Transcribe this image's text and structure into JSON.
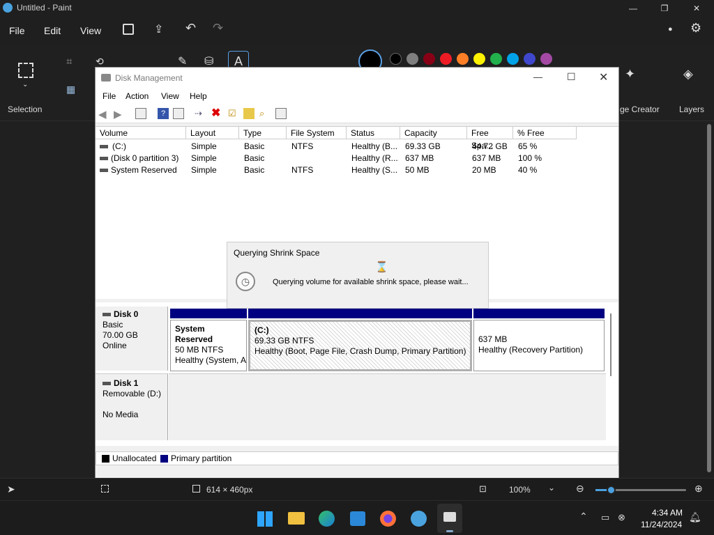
{
  "paint": {
    "title": "Untitled - Paint",
    "menu": [
      "File",
      "Edit",
      "View"
    ],
    "ribbon": {
      "selection": "Selection",
      "image_creator": "ge Creator",
      "layers": "Layers"
    },
    "colors": [
      "#000000",
      "#7f7f7f",
      "#880015",
      "#ed1c24",
      "#ff7f27",
      "#fff200",
      "#22b14c",
      "#00a2e8",
      "#3f48cc",
      "#a349a4"
    ],
    "status": {
      "size": "614 × 460px",
      "zoom": "100%",
      "zoom_fraction": 0.17
    }
  },
  "dm": {
    "title": "Disk Management",
    "menu": [
      "File",
      "Action",
      "View",
      "Help"
    ],
    "columns": [
      "Volume",
      "Layout",
      "Type",
      "File System",
      "Status",
      "Capacity",
      "Free Spa...",
      "% Free"
    ],
    "rows": [
      [
        "(C:)",
        "Simple",
        "Basic",
        "NTFS",
        "Healthy (B...",
        "69.33 GB",
        "44.72 GB",
        "65 %"
      ],
      [
        "(Disk 0 partition 3)",
        "Simple",
        "Basic",
        "",
        "Healthy (R...",
        "637 MB",
        "637 MB",
        "100 %"
      ],
      [
        "System Reserved",
        "Simple",
        "Basic",
        "NTFS",
        "Healthy (S...",
        "50 MB",
        "20 MB",
        "40 %"
      ]
    ],
    "disk0": {
      "name": "Disk 0",
      "type": "Basic",
      "size": "70.00 GB",
      "status": "Online"
    },
    "disk1": {
      "name": "Disk 1",
      "type": "Removable (D:)",
      "status": "No Media"
    },
    "partitions": [
      {
        "name": "System Reserved",
        "fs": "50 MB NTFS",
        "status": "Healthy (System, A"
      },
      {
        "name": "(C:)",
        "fs": "69.33 GB NTFS",
        "status": "Healthy (Boot, Page File, Crash Dump, Primary Partition)"
      },
      {
        "name": "",
        "fs": "637 MB",
        "status": "Healthy (Recovery Partition)"
      }
    ],
    "legend": {
      "unallocated": "Unallocated",
      "primary": "Primary partition"
    },
    "dialog": {
      "title": "Querying Shrink Space",
      "message": "Querying volume for available shrink space, please wait..."
    }
  },
  "taskbar": {
    "time": "4:34 AM",
    "date": "11/24/2024"
  }
}
